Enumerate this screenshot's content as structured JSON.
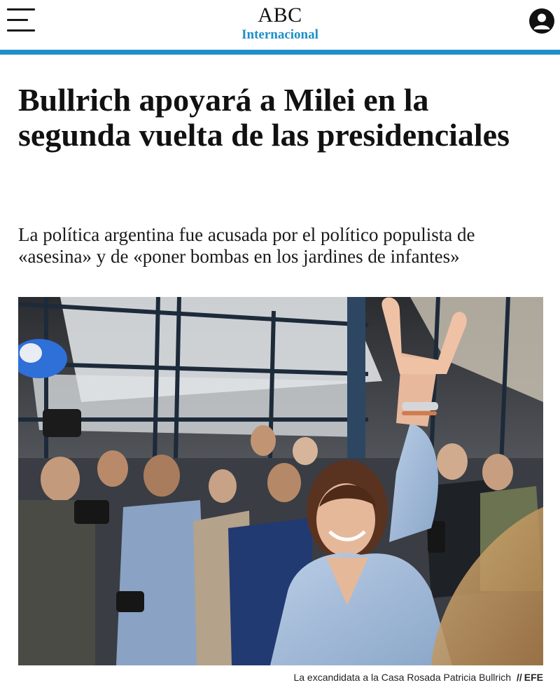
{
  "header": {
    "logo": "ABC",
    "section": "Internacional",
    "menu_icon": "hamburger-menu-icon",
    "user_icon": "user-account-icon",
    "accent_color": "#1f8fc9"
  },
  "article": {
    "headline": "Bullrich apoyará a Milei en la segunda vuelta de las presidenciales",
    "subtitle": "La política argentina fue acusada por el político populista de «asesina» y de «poner bombas en los jardines de infantes»",
    "photo": {
      "caption": "La excandidata a la Casa Rosada Patricia Bullrich",
      "credit_separator": "//",
      "credit": "EFE"
    }
  }
}
